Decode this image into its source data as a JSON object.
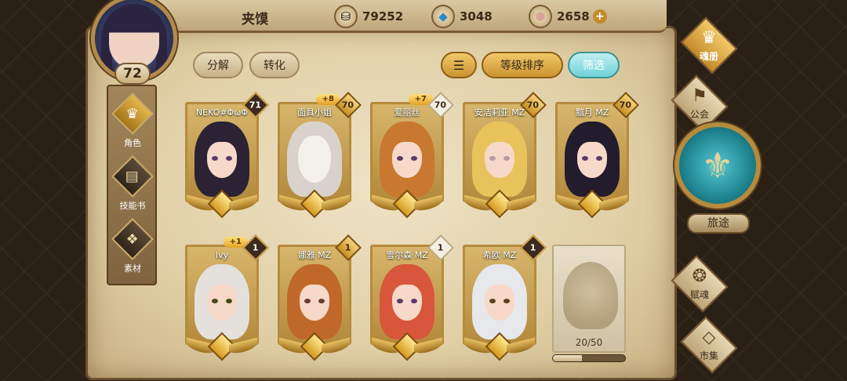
{
  "header": {
    "player_name": "夹馍",
    "player_level": "72",
    "currencies": [
      {
        "icon": "gold-coin-icon",
        "value": "79252"
      },
      {
        "icon": "blue-crystal-icon",
        "value": "3048"
      },
      {
        "icon": "pink-gem-icon",
        "value": "2658"
      }
    ],
    "plus_label": "+"
  },
  "side_tabs": [
    {
      "label": "角色",
      "icon": "character-icon",
      "active": true
    },
    {
      "label": "技能书",
      "icon": "skillbook-icon",
      "active": false
    },
    {
      "label": "素材",
      "icon": "material-icon",
      "active": false
    }
  ],
  "toolbar": {
    "decompose_label": "分解",
    "convert_label": "转化",
    "sort_order_icon": "sort-icon",
    "sort_label": "等级排序",
    "filter_label": "筛选"
  },
  "cards": [
    {
      "name": "NEKO#ΦωΦ",
      "level": "71",
      "badge": "dark",
      "plus": ""
    },
    {
      "name": "面具小姐",
      "level": "70",
      "badge": "gold",
      "plus": "+8"
    },
    {
      "name": "爱丽丝",
      "level": "70",
      "badge": "white",
      "plus": "+7"
    },
    {
      "name": "安洁莉亚 MZ",
      "level": "70",
      "badge": "gold",
      "plus": ""
    },
    {
      "name": "黯月 MZ",
      "level": "70",
      "badge": "gold",
      "plus": ""
    },
    {
      "name": "Ivy",
      "level": "1",
      "badge": "dark",
      "plus": "+1"
    },
    {
      "name": "娜雅 MZ",
      "level": "1",
      "badge": "gold",
      "plus": ""
    },
    {
      "name": "雪尔森 MZ",
      "level": "1",
      "badge": "white",
      "plus": ""
    },
    {
      "name": "希欧 MZ",
      "level": "1",
      "badge": "dark",
      "plus": ""
    }
  ],
  "locked_card": {
    "count_text": "20/50",
    "progress_fraction": 0.4
  },
  "right_menu": [
    {
      "label": "魂册",
      "icon": "soulbook-icon",
      "active": true
    },
    {
      "label": "公会",
      "icon": "guild-icon",
      "active": false
    },
    {
      "label": "旅途",
      "icon": "journey-icon",
      "active": false
    },
    {
      "label": "赋魂",
      "icon": "infuse-icon",
      "active": false
    },
    {
      "label": "市集",
      "icon": "market-icon",
      "active": false
    }
  ],
  "colors": {
    "parchment": "#e0cfa6",
    "frame_gold": "#b58b3d",
    "accent_teal": "#6fd2d6",
    "accent_gold": "#cc9330"
  }
}
